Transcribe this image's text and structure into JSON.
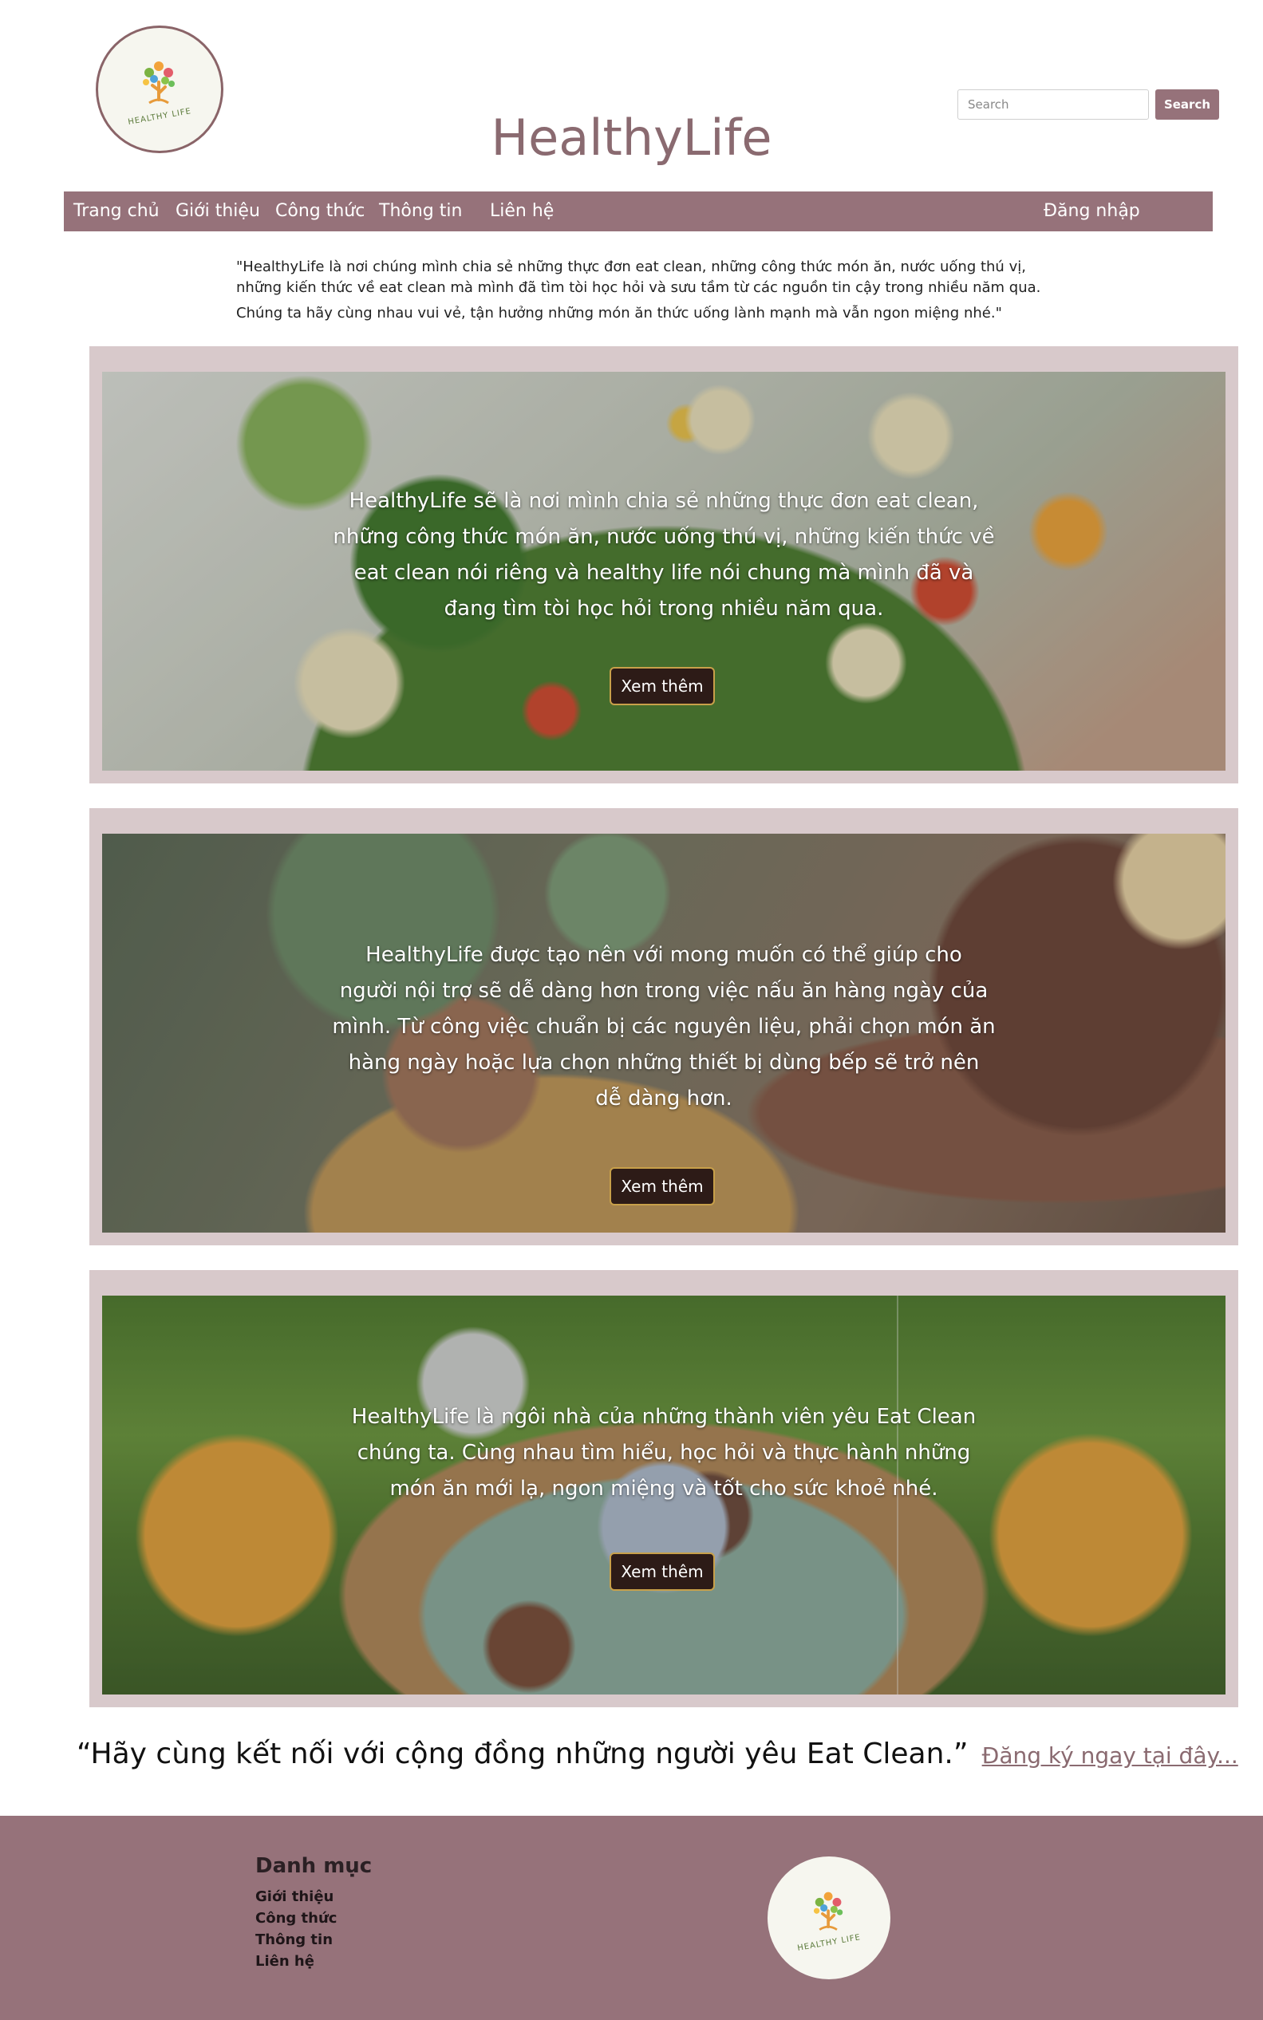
{
  "header": {
    "logo_text": "HEALTHY LIFE",
    "site_title": "HealthyLife",
    "search_placeholder": "Search",
    "search_button": "Search"
  },
  "nav": {
    "items": [
      "Trang chủ",
      "Giới thiệu",
      "Công thức",
      "Thông tin",
      "Liên hệ"
    ],
    "login": "Đăng nhập"
  },
  "intro": {
    "lines": [
      "\"HealthyLife là nơi chúng mình chia sẻ những thực đơn eat clean, những công thức món ăn, nước uống thú vị,",
      "những kiến thức về eat clean mà mình đã tìm tòi học hỏi và sưu tầm từ các nguồn tin cậy trong nhiều năm qua.",
      "Chúng ta hãy cùng nhau vui vẻ, tận hưởng những món ăn thức uống lành mạnh mà vẫn ngon miệng nhé.\""
    ]
  },
  "cards": [
    {
      "lines": [
        "HealthyLife sẽ là nơi mình chia sẻ những thực đơn eat clean,",
        "những công thức món ăn, nước uống thú vị, những kiến thức về",
        "eat clean nói riêng và healthy life nói chung mà mình đã và",
        "đang tìm tòi học hỏi trong nhiều năm qua."
      ],
      "button": "Xem thêm"
    },
    {
      "lines": [
        "HealthyLife được tạo nên với mong muốn có thể giúp cho",
        "người nội trợ sẽ dễ dàng hơn trong việc nấu ăn hàng ngày của",
        "mình. Từ công việc chuẩn bị các nguyên liệu, phải chọn món ăn",
        "hàng ngày hoặc lựa chọn những thiết bị dùng bếp sẽ trở nên",
        "dễ dàng hơn."
      ],
      "button": "Xem thêm"
    },
    {
      "lines": [
        "HealthyLife là ngôi nhà của những thành viên yêu Eat Clean",
        "chúng ta. Cùng nhau tìm hiểu, học hỏi và thực hành những",
        "món ăn mới lạ, ngon miệng và tốt cho sức khoẻ nhé."
      ],
      "button": "Xem thêm"
    }
  ],
  "cta": {
    "quote": "“Hãy cùng kết nối với cộng đồng những người yêu Eat Clean.”",
    "link": "Đăng ký ngay tại đây..."
  },
  "footer": {
    "heading": "Danh mục",
    "links": [
      "Giới thiệu",
      "Công thức",
      "Thông tin",
      "Liên hệ"
    ],
    "logo_text": "HEALTHY LIFE"
  },
  "colors": {
    "brand": "#96727a",
    "title": "#8a6a70",
    "card_frame": "#d8c9cb",
    "button_bg": "#2d1b17",
    "button_border": "#c8a04a"
  },
  "icons": [
    "tree-logo-icon"
  ]
}
